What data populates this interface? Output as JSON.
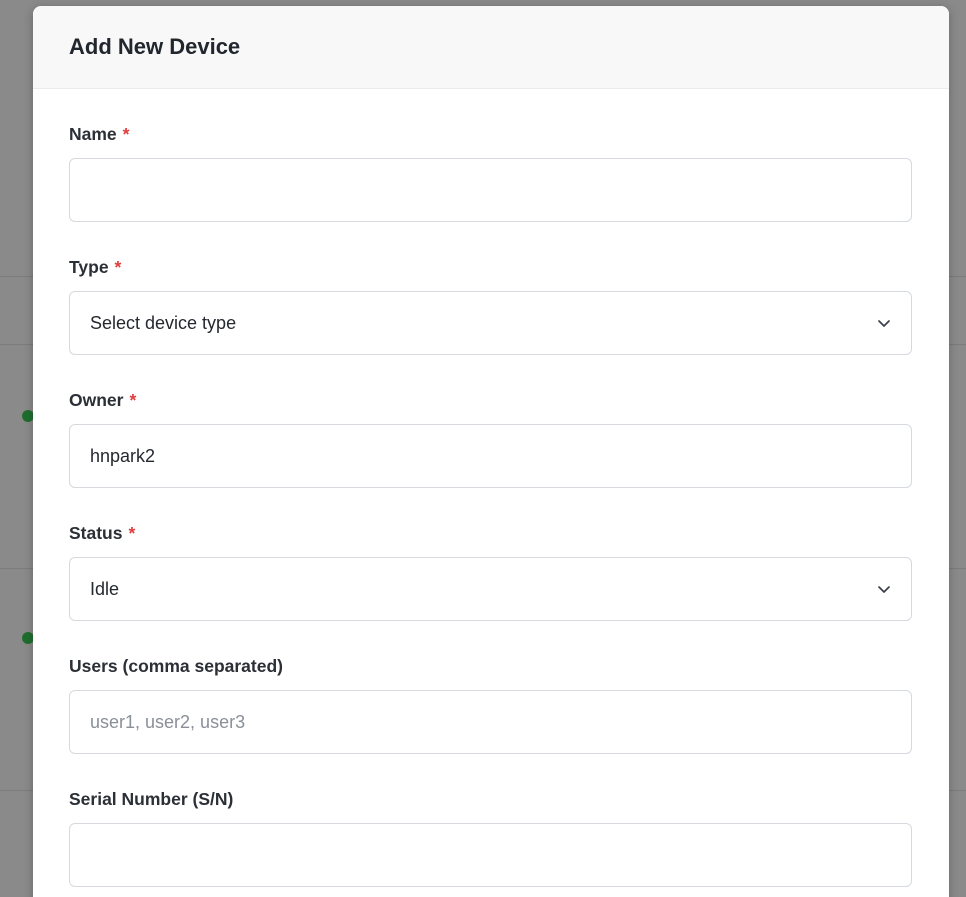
{
  "modal": {
    "title": "Add New Device"
  },
  "fields": {
    "name": {
      "label": "Name",
      "required_mark": "*",
      "value": ""
    },
    "type": {
      "label": "Type",
      "required_mark": "*",
      "selected": "Select device type"
    },
    "owner": {
      "label": "Owner",
      "required_mark": "*",
      "value": "hnpark2"
    },
    "status": {
      "label": "Status",
      "required_mark": "*",
      "selected": "Idle"
    },
    "users": {
      "label": "Users (comma separated)",
      "placeholder": "user1, user2, user3",
      "value": ""
    },
    "serial": {
      "label": "Serial Number (S/N)",
      "value": ""
    }
  },
  "icons": {
    "type_chevron": "chevron-down-icon",
    "status_chevron": "chevron-down-icon"
  },
  "colors": {
    "required": "#e03c3c",
    "status_dot": "#1f6e2e",
    "overlay": "#8a8a8a"
  }
}
